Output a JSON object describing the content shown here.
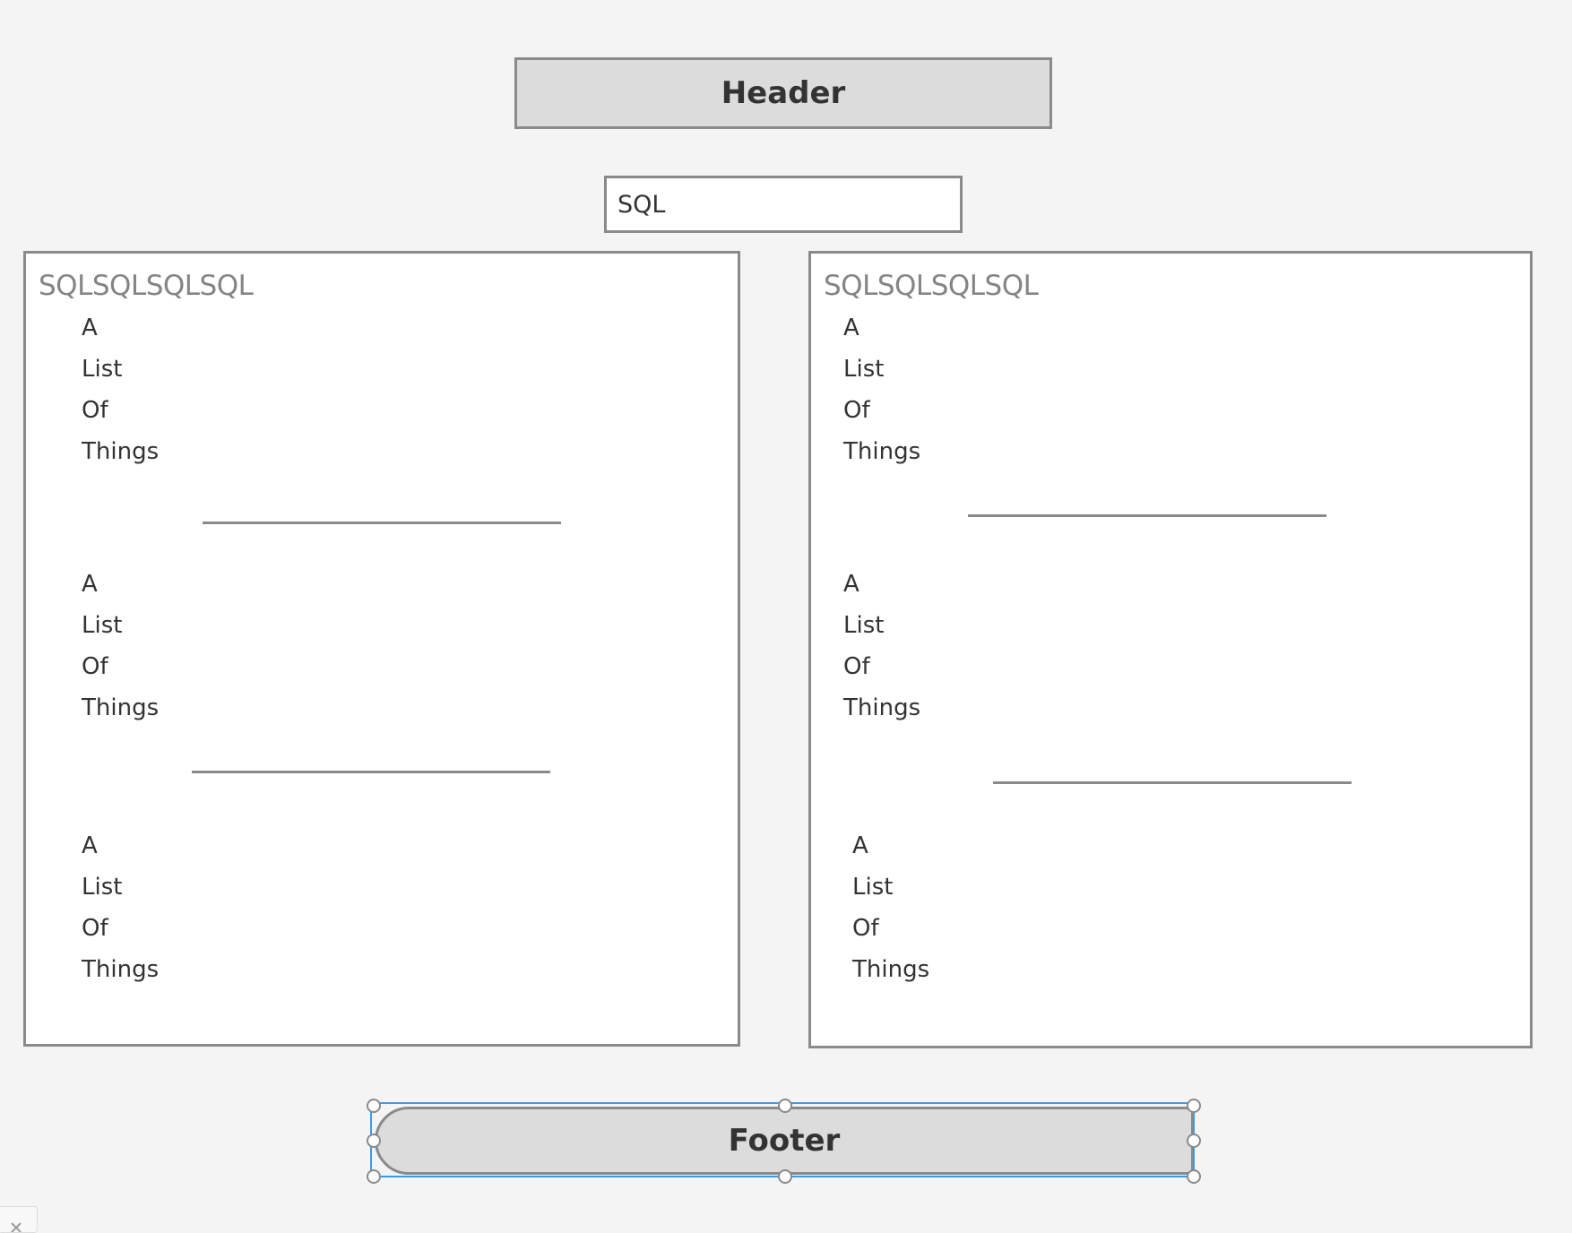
{
  "header": {
    "label": "Header"
  },
  "search": {
    "value": "SQL"
  },
  "panels": [
    {
      "title": "SQLSQLSQLSQL",
      "groups": [
        [
          "A",
          "List",
          "Of",
          "Things"
        ],
        [
          "A",
          "List",
          "Of",
          "Things"
        ],
        [
          "A",
          "List",
          "Of",
          "Things"
        ]
      ]
    },
    {
      "title": "SQLSQLSQLSQL",
      "groups": [
        [
          "A",
          "List",
          "Of",
          "Things"
        ],
        [
          "A",
          "List",
          "Of",
          "Things"
        ],
        [
          "A",
          "List",
          "Of",
          "Things"
        ]
      ]
    }
  ],
  "footer": {
    "label": "Footer"
  },
  "colors": {
    "selection": "#3b9ae8",
    "border": "#8a8a8a",
    "fill": "#dcdcdc"
  }
}
